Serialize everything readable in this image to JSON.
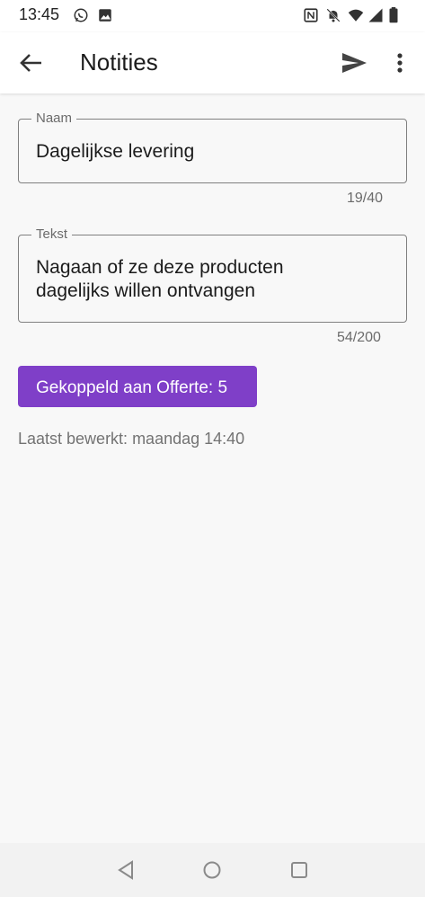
{
  "status_bar": {
    "time": "13:45",
    "icons": [
      "whatsapp-icon",
      "image-icon",
      "nfc-icon",
      "muted-bell-icon",
      "wifi-icon",
      "signal-icon",
      "battery-icon"
    ]
  },
  "app_bar": {
    "title": "Notities",
    "back_icon": "arrow-left-icon",
    "send_icon": "send-icon",
    "more_icon": "more-vertical-icon"
  },
  "form": {
    "name": {
      "label": "Naam",
      "value": "Dagelijkse levering",
      "counter": "19/40"
    },
    "text": {
      "label": "Tekst",
      "value_line1": "Nagaan of ze deze producten",
      "value_line2": "dagelijks willen ontvangen",
      "counter": "54/200"
    }
  },
  "linked_button": {
    "label": "Gekoppeld aan Offerte: 5"
  },
  "last_edited": "Laatst bewerkt: maandag 14:40",
  "nav_bar": {
    "icons": [
      "nav-back-icon",
      "nav-home-icon",
      "nav-recents-icon"
    ]
  },
  "colors": {
    "accent": "#7f3fc8",
    "background": "#f8f8f8",
    "outline": "#808080"
  }
}
